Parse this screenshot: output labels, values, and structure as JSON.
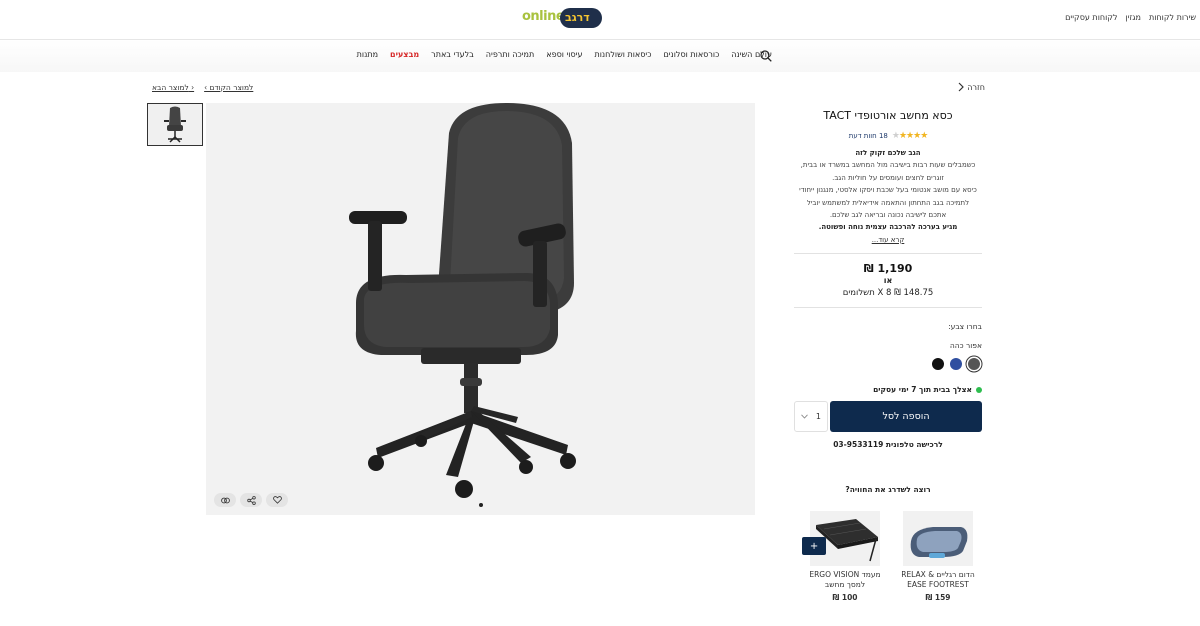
{
  "header": {
    "top_links": [
      "שירות לקוחות",
      "מגזין",
      "לקוחות עסקיים"
    ],
    "logo_main": "דרגב",
    "logo_suffix": "online"
  },
  "nav": {
    "items": [
      "עולם השינה",
      "כורסאות וסלונים",
      "כיסאות ושולחנות",
      "עיסוי וספא",
      "תמיכה ותרפיה",
      "בלעדי באתר",
      "מבצעים",
      "מתנות"
    ],
    "sale_color": "#d62828"
  },
  "breadcrumb": {
    "back": "חזרה",
    "prev": "‹ למוצר הקודם",
    "next": "למוצר הבא ›"
  },
  "product": {
    "title": "כסא מחשב אורטופדי TACT",
    "rating": 4,
    "rating_max": 5,
    "reviews": "18 חוות דעת",
    "desc_heading": "הגב שלכם זקוק לזה",
    "desc_lines": [
      "כשמבלים שעות רבות בישיבה מול המחשב במשרד או בבית,",
      "זוגרים לחצים ועומסים על חוליות הגב.",
      "כיסא עם מושב אנטומי בעל שכבת ויסקו אלסטי, מנגנון ייחודי",
      "לתמיכה בגב התחתון והתאמה אידיאלית למשתמש יוביל",
      "אתכם לישיבה נכונה ובריאה לגב שלכם."
    ],
    "desc_bold": "מגיע בערכה להרכבה עצמית נוחה ופשוטה.",
    "read_more": "קרא עוד...",
    "price": "1,190 ₪",
    "or": "או",
    "installments": "148.75 ₪ X 8 תשלומים",
    "choose_color": "בחרו צבע:",
    "color_name": "אפור כהה",
    "swatches": [
      "#555555",
      "#2f4fa0",
      "#111111"
    ],
    "delivery": "אצלך בבית תוך 7 ימי עסקים",
    "add_to_cart": "הוספה לסל",
    "qty": "1",
    "phone": "לרכישה טלפונית 03-9533119",
    "upgrade": "רוצה לשדרג את החוויה?"
  },
  "recommendations": [
    {
      "name": "הדום רגליים & RELAX EASE FOOTREST",
      "price": "159 ₪"
    },
    {
      "name": "מעמד ERGO VISION למסך מחשב",
      "price": "100 ₪"
    }
  ],
  "icons": {
    "search": "search-icon",
    "back": "chevron-right-icon",
    "compare": "compare-icon",
    "share": "share-icon",
    "wishlist": "heart-icon",
    "plus": "plus-icon"
  },
  "colors": {
    "brand_dark": "#0e2a4d",
    "accent_green": "#2ebd4f",
    "star": "#f1b521"
  }
}
